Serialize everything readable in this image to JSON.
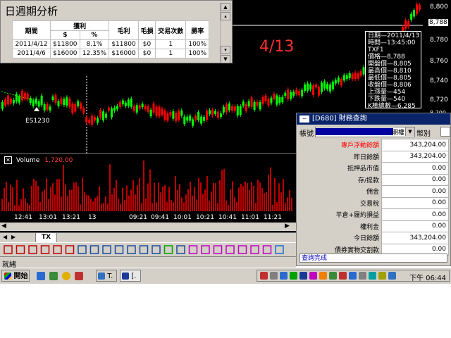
{
  "chart": {
    "annotation": "4/13",
    "marker_label": "ES1230",
    "volume_label": "Volume",
    "volume_value": "1,720.00",
    "price_labels": [
      "8,800",
      "8,788",
      "8,780",
      "8,760",
      "8,740",
      "8,720",
      "8,700"
    ],
    "time_labels": [
      "12:41",
      "13:01",
      "13:21",
      "13",
      "09:21",
      "09:41",
      "10:01",
      "10:21",
      "10:41",
      "11:01",
      "11:21"
    ],
    "tab_label": "TX"
  },
  "colors": {
    "up": "#ff0000",
    "down": "#00ff00",
    "volume": "#c00000",
    "price_line": "#ffffff"
  },
  "analysis": {
    "title": "日週期分析",
    "headers": [
      "期間",
      "獲利",
      "毛利",
      "毛損",
      "交易次數",
      "勝率"
    ],
    "subheaders": [
      "$",
      "%"
    ],
    "rows": [
      {
        "period": "2011/4/12",
        "dollar": "$11800",
        "pct": "8.1%",
        "gross_profit": "$11800",
        "gross_loss": "$0",
        "trades": "1",
        "win_rate": "100%"
      },
      {
        "period": "2011/4/6",
        "dollar": "$16000",
        "pct": "12.35%",
        "gross_profit": "$16000",
        "gross_loss": "$0",
        "trades": "1",
        "win_rate": "100%"
      }
    ]
  },
  "info": {
    "lines": [
      "日期—2011/4/13",
      "時間—13:45:00",
      "TXF1",
      "價格—8,788",
      "開盤價—8,805",
      "最高價—8,810",
      "最低價—8,805",
      "收盤價—8,806",
      "上漲量—454",
      "下跌量—540",
      "K棒總數—6,285"
    ]
  },
  "finance": {
    "title": "[D680] 財務查詢",
    "account_label": "帳號",
    "account_type": "期權",
    "currency_label": "幣別",
    "rows": [
      {
        "label": "專戶浮動餘額",
        "value": "343,204.00",
        "highlight": true
      },
      {
        "label": "昨日餘額",
        "value": "343,204.00"
      },
      {
        "label": "抵押品市值",
        "value": "0.00"
      },
      {
        "label": "存/提款",
        "value": "0.00"
      },
      {
        "label": "佣金",
        "value": "0.00"
      },
      {
        "label": "交易稅",
        "value": "0.00"
      },
      {
        "label": "平倉+履約損益",
        "value": "0.00"
      },
      {
        "label": "權利金",
        "value": "0.00"
      },
      {
        "label": "今日餘額",
        "value": "343,204.00"
      },
      {
        "label": "債券實物交割款",
        "value": "0.00"
      }
    ],
    "status": "查詢完成"
  },
  "statusbar": {
    "text": "就緒"
  },
  "taskbar": {
    "start_label": "開始",
    "task1_label": "T.",
    "task2_label": "[.",
    "clock": "下午 06:44"
  }
}
